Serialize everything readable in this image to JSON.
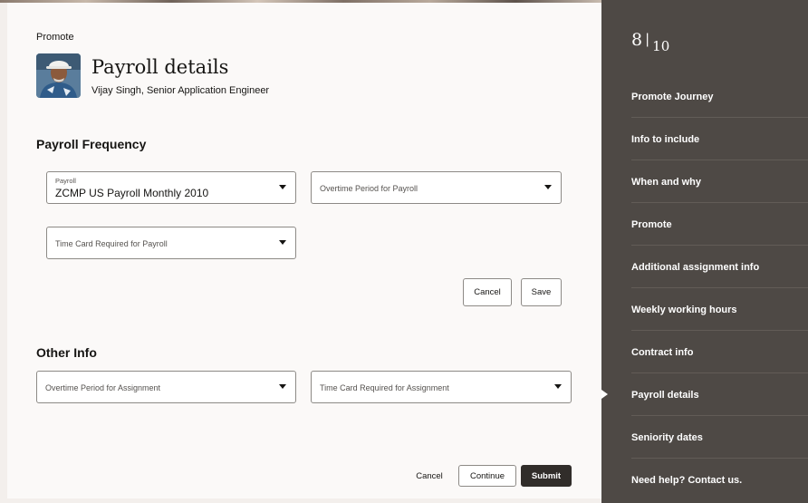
{
  "header": {
    "eyebrow": "Promote",
    "title": "Payroll details",
    "person": "Vijay Singh, Senior Application Engineer"
  },
  "payroll_frequency": {
    "title": "Payroll Frequency",
    "payroll_field": {
      "label": "Payroll",
      "value": "ZCMP US Payroll Monthly 2010"
    },
    "overtime_period_field": {
      "label": "Overtime Period for Payroll"
    },
    "time_card_field": {
      "label": "Time Card Required for Payroll"
    },
    "cancel_label": "Cancel",
    "save_label": "Save"
  },
  "other_info": {
    "title": "Other Info",
    "overtime_assignment_field": {
      "label": "Overtime Period for Assignment"
    },
    "time_card_assignment_field": {
      "label": "Time Card Required for Assignment"
    }
  },
  "footer": {
    "cancel_label": "Cancel",
    "continue_label": "Continue",
    "submit_label": "Submit"
  },
  "sidebar": {
    "step_current": "8",
    "step_separator": "|",
    "step_total": "10",
    "current_item": "Payroll details",
    "items": [
      {
        "label": "Promote Journey"
      },
      {
        "label": "Info to include"
      },
      {
        "label": "When and why"
      },
      {
        "label": "Promote"
      },
      {
        "label": "Additional assignment info"
      },
      {
        "label": "Weekly working hours"
      },
      {
        "label": "Contract info"
      },
      {
        "label": "Payroll details"
      },
      {
        "label": "Seniority dates"
      },
      {
        "label": "Need help? Contact us."
      }
    ]
  },
  "colors": {
    "sidebar_bg": "#4e4945",
    "primary_button": "#312d2a",
    "page_bg": "#fbf9f8"
  }
}
